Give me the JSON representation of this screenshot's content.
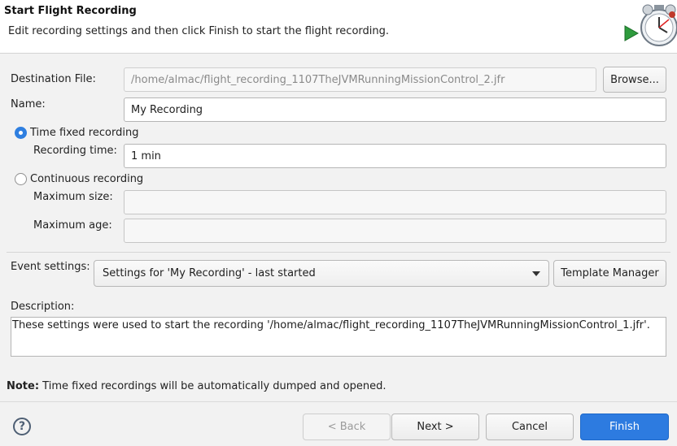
{
  "header": {
    "title": "Start Flight Recording",
    "message": "Edit recording settings and then click Finish to start the flight recording.",
    "icon": "stopwatch-record-icon"
  },
  "form": {
    "destination_label": "Destination File:",
    "destination_value": "/home/almac/flight_recording_1107TheJVMRunningMissionControl_2.jfr",
    "browse_label": "Browse...",
    "name_label": "Name:",
    "name_value": "My Recording",
    "time_fixed_label": "Time fixed recording",
    "time_fixed_selected": true,
    "recording_time_label": "Recording time:",
    "recording_time_value": "1 min",
    "continuous_label": "Continuous recording",
    "continuous_selected": false,
    "max_size_label": "Maximum size:",
    "max_size_value": "",
    "max_age_label": "Maximum age:",
    "max_age_value": "",
    "event_settings_label": "Event settings:",
    "event_settings_value": "Settings for 'My Recording' - last started",
    "template_manager_label": "Template Manager",
    "description_label": "Description:",
    "description_value": "These settings were used to start the recording '/home/almac/flight_recording_1107TheJVMRunningMissionControl_1.jfr'."
  },
  "note": {
    "bold": "Note:",
    "text": " Time fixed recordings will be automatically dumped and opened."
  },
  "footer": {
    "help_glyph": "?",
    "back_label": "< Back",
    "next_label": "Next >",
    "cancel_label": "Cancel",
    "finish_label": "Finish"
  },
  "colors": {
    "accent": "#2d7be0",
    "window_bg": "#f2f2f2",
    "banner_bg": "#ffffff"
  }
}
